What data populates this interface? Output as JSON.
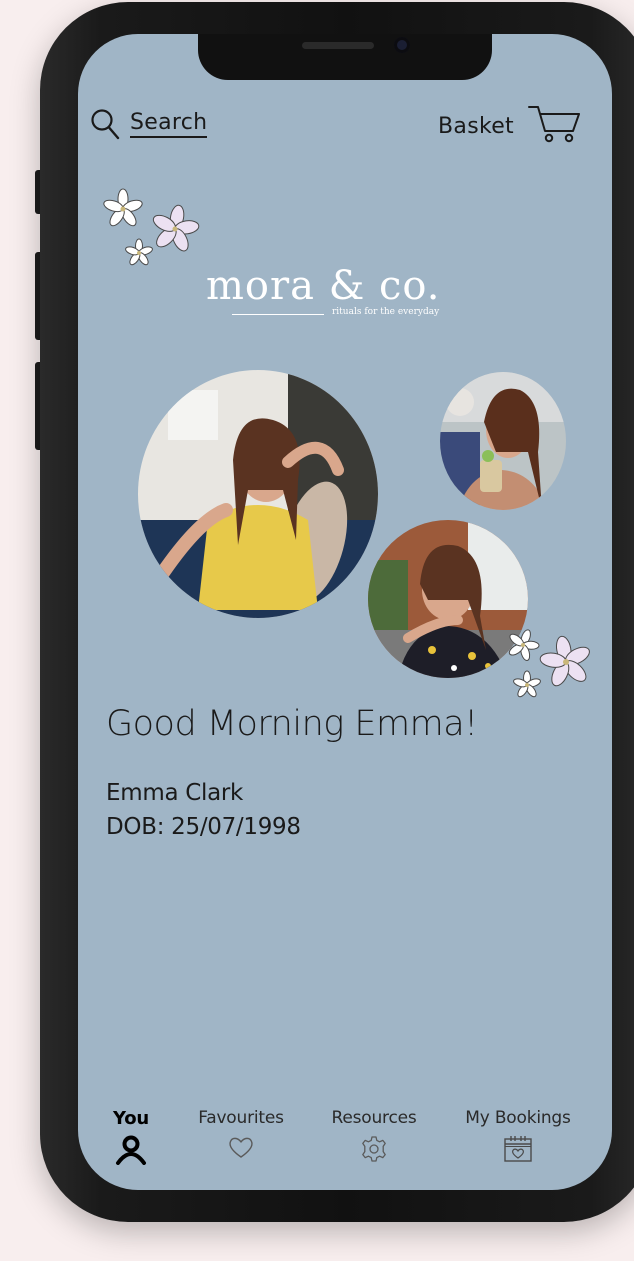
{
  "top_bar": {
    "search_label": "Search",
    "basket_label": "Basket"
  },
  "brand": {
    "name": "mora & co.",
    "tagline": "rituals for the everyday"
  },
  "greeting": "Good Morning Emma!",
  "profile": {
    "name": "Emma Clark",
    "dob": "DOB: 25/07/1998"
  },
  "nav": {
    "items": [
      {
        "label": "You",
        "icon": "person-icon",
        "active": true
      },
      {
        "label": "Favourites",
        "icon": "heart-icon",
        "active": false
      },
      {
        "label": "Resources",
        "icon": "gear-icon",
        "active": false
      },
      {
        "label": "My Bookings",
        "icon": "calendar-heart-icon",
        "active": false
      }
    ]
  },
  "colors": {
    "screen_background": "#a0b5c6",
    "text": "#1a1a1a",
    "logo": "#ffffff",
    "flower_petal": "#ece1f2"
  }
}
